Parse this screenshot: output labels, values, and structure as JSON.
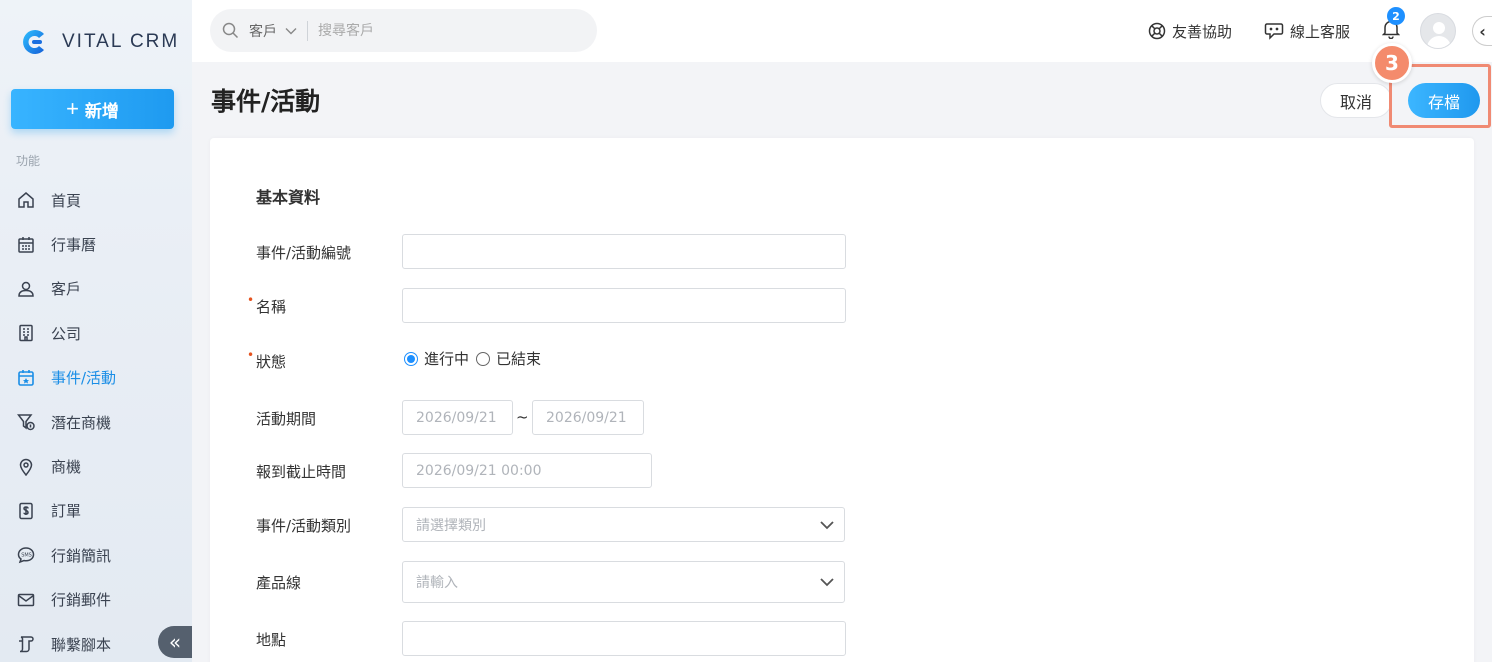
{
  "brand": {
    "name": "VITAL CRM"
  },
  "sidebar": {
    "new_label": "新增",
    "section_label": "功能",
    "items": [
      {
        "label": "首頁",
        "icon": "home-icon"
      },
      {
        "label": "行事曆",
        "icon": "calendar-icon"
      },
      {
        "label": "客戶",
        "icon": "customer-icon"
      },
      {
        "label": "公司",
        "icon": "building-icon"
      },
      {
        "label": "事件/活動",
        "icon": "event-icon",
        "active": true
      },
      {
        "label": "潛在商機",
        "icon": "funnel-icon"
      },
      {
        "label": "商機",
        "icon": "location-icon"
      },
      {
        "label": "訂單",
        "icon": "order-icon"
      },
      {
        "label": "行銷簡訊",
        "icon": "sms-icon"
      },
      {
        "label": "行銷郵件",
        "icon": "mail-icon"
      },
      {
        "label": "聯繫腳本",
        "icon": "script-icon"
      }
    ],
    "collapse_glyph": "«"
  },
  "topbar": {
    "search_scope": "客戶",
    "search_placeholder": "搜尋客戶",
    "help_label": "友善協助",
    "support_label": "線上客服",
    "notification_count": "2",
    "edge_glyph": "‹"
  },
  "page": {
    "title": "事件/活動",
    "cancel_label": "取消",
    "save_label": "存檔",
    "step_number": "3",
    "accent_color": "#1e90ff",
    "highlight_color": "#f08a73"
  },
  "form": {
    "section_title": "基本資料",
    "fields": {
      "event_number": {
        "label": "事件/活動編號",
        "value": ""
      },
      "name": {
        "label": "名稱",
        "value": ""
      },
      "status": {
        "label": "狀態",
        "options": [
          "進行中",
          "已結束"
        ],
        "selected": "進行中"
      },
      "period": {
        "label": "活動期間",
        "start_placeholder": "2026/09/21",
        "end_placeholder": "2026/09/21",
        "separator": "~"
      },
      "checkin_deadline": {
        "label": "報到截止時間",
        "placeholder": "2026/09/21 00:00"
      },
      "category": {
        "label": "事件/活動類別",
        "placeholder": "請選擇類別"
      },
      "product_line": {
        "label": "產品線",
        "placeholder": "請輸入"
      },
      "location": {
        "label": "地點",
        "value": ""
      }
    }
  }
}
